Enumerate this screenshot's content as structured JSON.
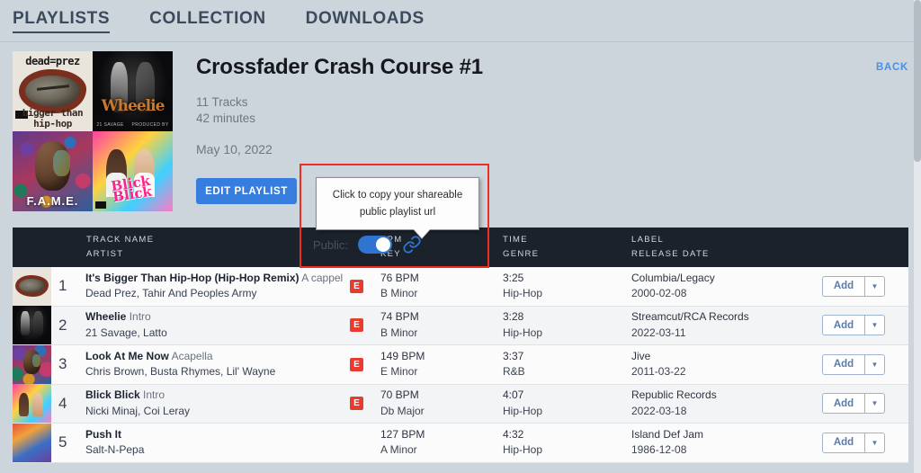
{
  "nav": {
    "tabs": [
      {
        "label": "PLAYLISTS",
        "active": true
      },
      {
        "label": "COLLECTION",
        "active": false
      },
      {
        "label": "DOWNLOADS",
        "active": false
      }
    ]
  },
  "header": {
    "title": "Crossfader Crash Course #1",
    "track_count": "11 Tracks",
    "duration": "42 minutes",
    "date": "May 10, 2022",
    "edit_label": "EDIT PLAYLIST",
    "back_label": "BACK",
    "artwork": [
      {
        "name": "dead-prez-bigger-than-hip-hop",
        "top_text": "dead=prez",
        "bottom_text": "bigger than hip-hop"
      },
      {
        "name": "wheelie-21-savage-latto",
        "title_text": "Wheelie",
        "credit_left": "21 SAVAGE",
        "credit_right": "PRODUCED BY"
      },
      {
        "name": "chris-brown-fame",
        "caption": "F.A.M.E."
      },
      {
        "name": "nicki-minaj-blick-blick",
        "caption": "Blick Blick"
      }
    ]
  },
  "share": {
    "tooltip_line1": "Click to copy your shareable",
    "tooltip_line2": "public playlist url",
    "public_label": "Public:",
    "toggle_on": true,
    "link_icon": "chain-link-icon",
    "highlight_color": "#ee2d23"
  },
  "table": {
    "headers": {
      "track_name": "TRACK NAME",
      "artist": "ARTIST",
      "bpm": "BPM",
      "key": "KEY",
      "time": "TIME",
      "genre": "GENRE",
      "label": "LABEL",
      "release_date": "RELEASE DATE"
    },
    "add_label": "Add",
    "dropdown_icon": "chevron-down-icon",
    "explicit_badge": "E",
    "rows": [
      {
        "num": "1",
        "title": "It's Bigger Than Hip-Hop (Hip-Hop Remix)",
        "subtitle": "A cappella",
        "artist": "Dead Prez, Tahir And Peoples Army",
        "explicit": true,
        "bpm": "76 BPM",
        "key": "B Minor",
        "time": "3:25",
        "genre": "Hip-Hop",
        "label": "Columbia/Legacy",
        "release_date": "2000-02-08",
        "art": "art1"
      },
      {
        "num": "2",
        "title": "Wheelie",
        "subtitle": "Intro",
        "artist": "21 Savage, Latto",
        "explicit": true,
        "bpm": "74 BPM",
        "key": "B Minor",
        "time": "3:28",
        "genre": "Hip-Hop",
        "label": "Streamcut/RCA Records",
        "release_date": "2022-03-11",
        "art": "art2"
      },
      {
        "num": "3",
        "title": "Look At Me Now",
        "subtitle": "Acapella",
        "artist": "Chris Brown, Busta Rhymes, Lil' Wayne",
        "explicit": true,
        "bpm": "149 BPM",
        "key": "E Minor",
        "time": "3:37",
        "genre": "R&B",
        "label": "Jive",
        "release_date": "2011-03-22",
        "art": "art3"
      },
      {
        "num": "4",
        "title": "Blick Blick",
        "subtitle": "Intro",
        "artist": "Nicki Minaj, Coi Leray",
        "explicit": true,
        "bpm": "70 BPM",
        "key": "Db Major",
        "time": "4:07",
        "genre": "Hip-Hop",
        "label": "Republic Records",
        "release_date": "2022-03-18",
        "art": "art4"
      },
      {
        "num": "5",
        "title": "Push It",
        "subtitle": "",
        "artist": "Salt-N-Pepa",
        "explicit": false,
        "bpm": "127 BPM",
        "key": "A Minor",
        "time": "4:32",
        "genre": "Hip-Hop",
        "label": "Island Def Jam",
        "release_date": "1986-12-08",
        "art": "art5"
      }
    ]
  },
  "colors": {
    "page_bg": "#ccd4dc",
    "accent_blue": "#377dde",
    "header_dark": "#1c222c",
    "explicit_red": "#eb3b2e"
  }
}
